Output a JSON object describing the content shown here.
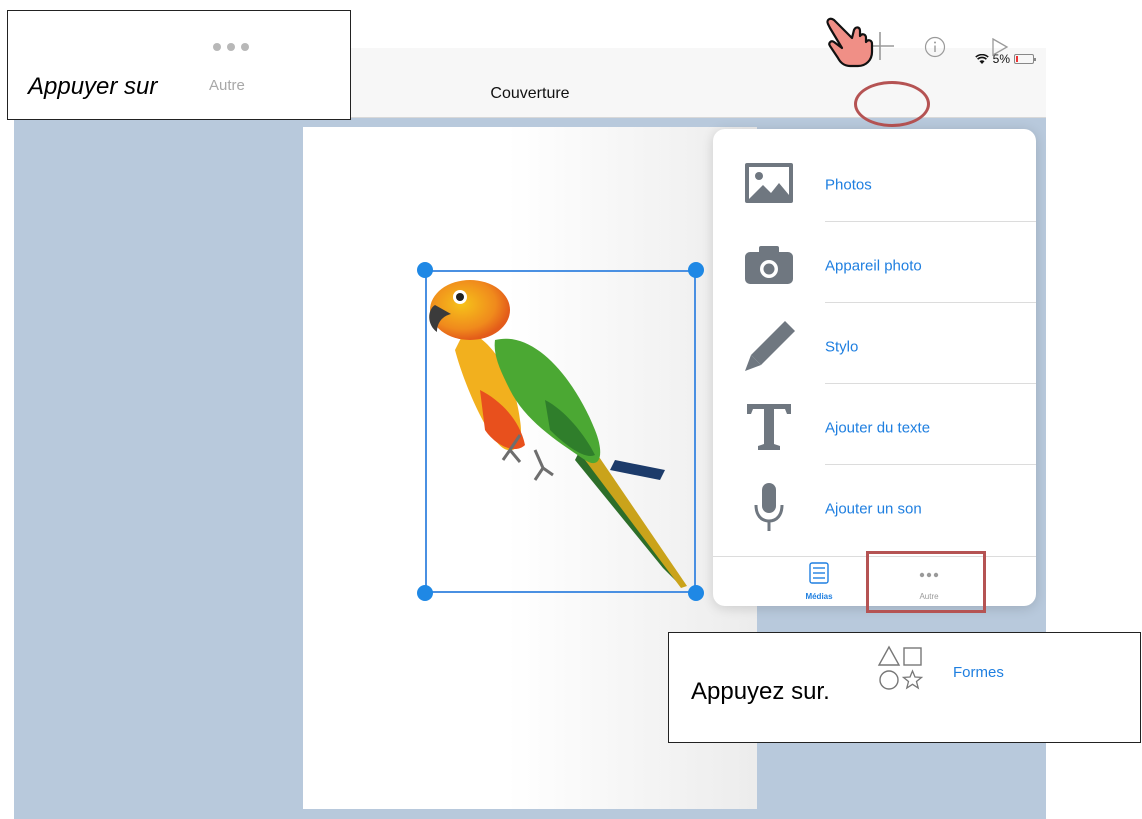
{
  "status_bar": {
    "battery": "5%"
  },
  "nav": {
    "title": "Couverture"
  },
  "popover": {
    "items": [
      {
        "label": "Photos",
        "icon": "photos-icon"
      },
      {
        "label": "Appareil photo",
        "icon": "camera-icon"
      },
      {
        "label": "Stylo",
        "icon": "pen-icon"
      },
      {
        "label": "Ajouter du texte",
        "icon": "text-icon"
      },
      {
        "label": "Ajouter un son",
        "icon": "microphone-icon"
      }
    ],
    "tabs": [
      {
        "label": "Médias",
        "icon": "list-icon",
        "selected": true
      },
      {
        "label": "Autre",
        "icon": "more-icon",
        "selected": false
      }
    ]
  },
  "callout_top": {
    "text": "Appuyer sur",
    "button_label": "Autre"
  },
  "callout_bottom": {
    "text": "Appuyez sur.",
    "shapes_label": "Formes"
  },
  "colors": {
    "accent": "#1f7fe0",
    "highlight": "#b55353",
    "canvas_bg": "#b8c9dc",
    "selection": "#4a90e2"
  }
}
